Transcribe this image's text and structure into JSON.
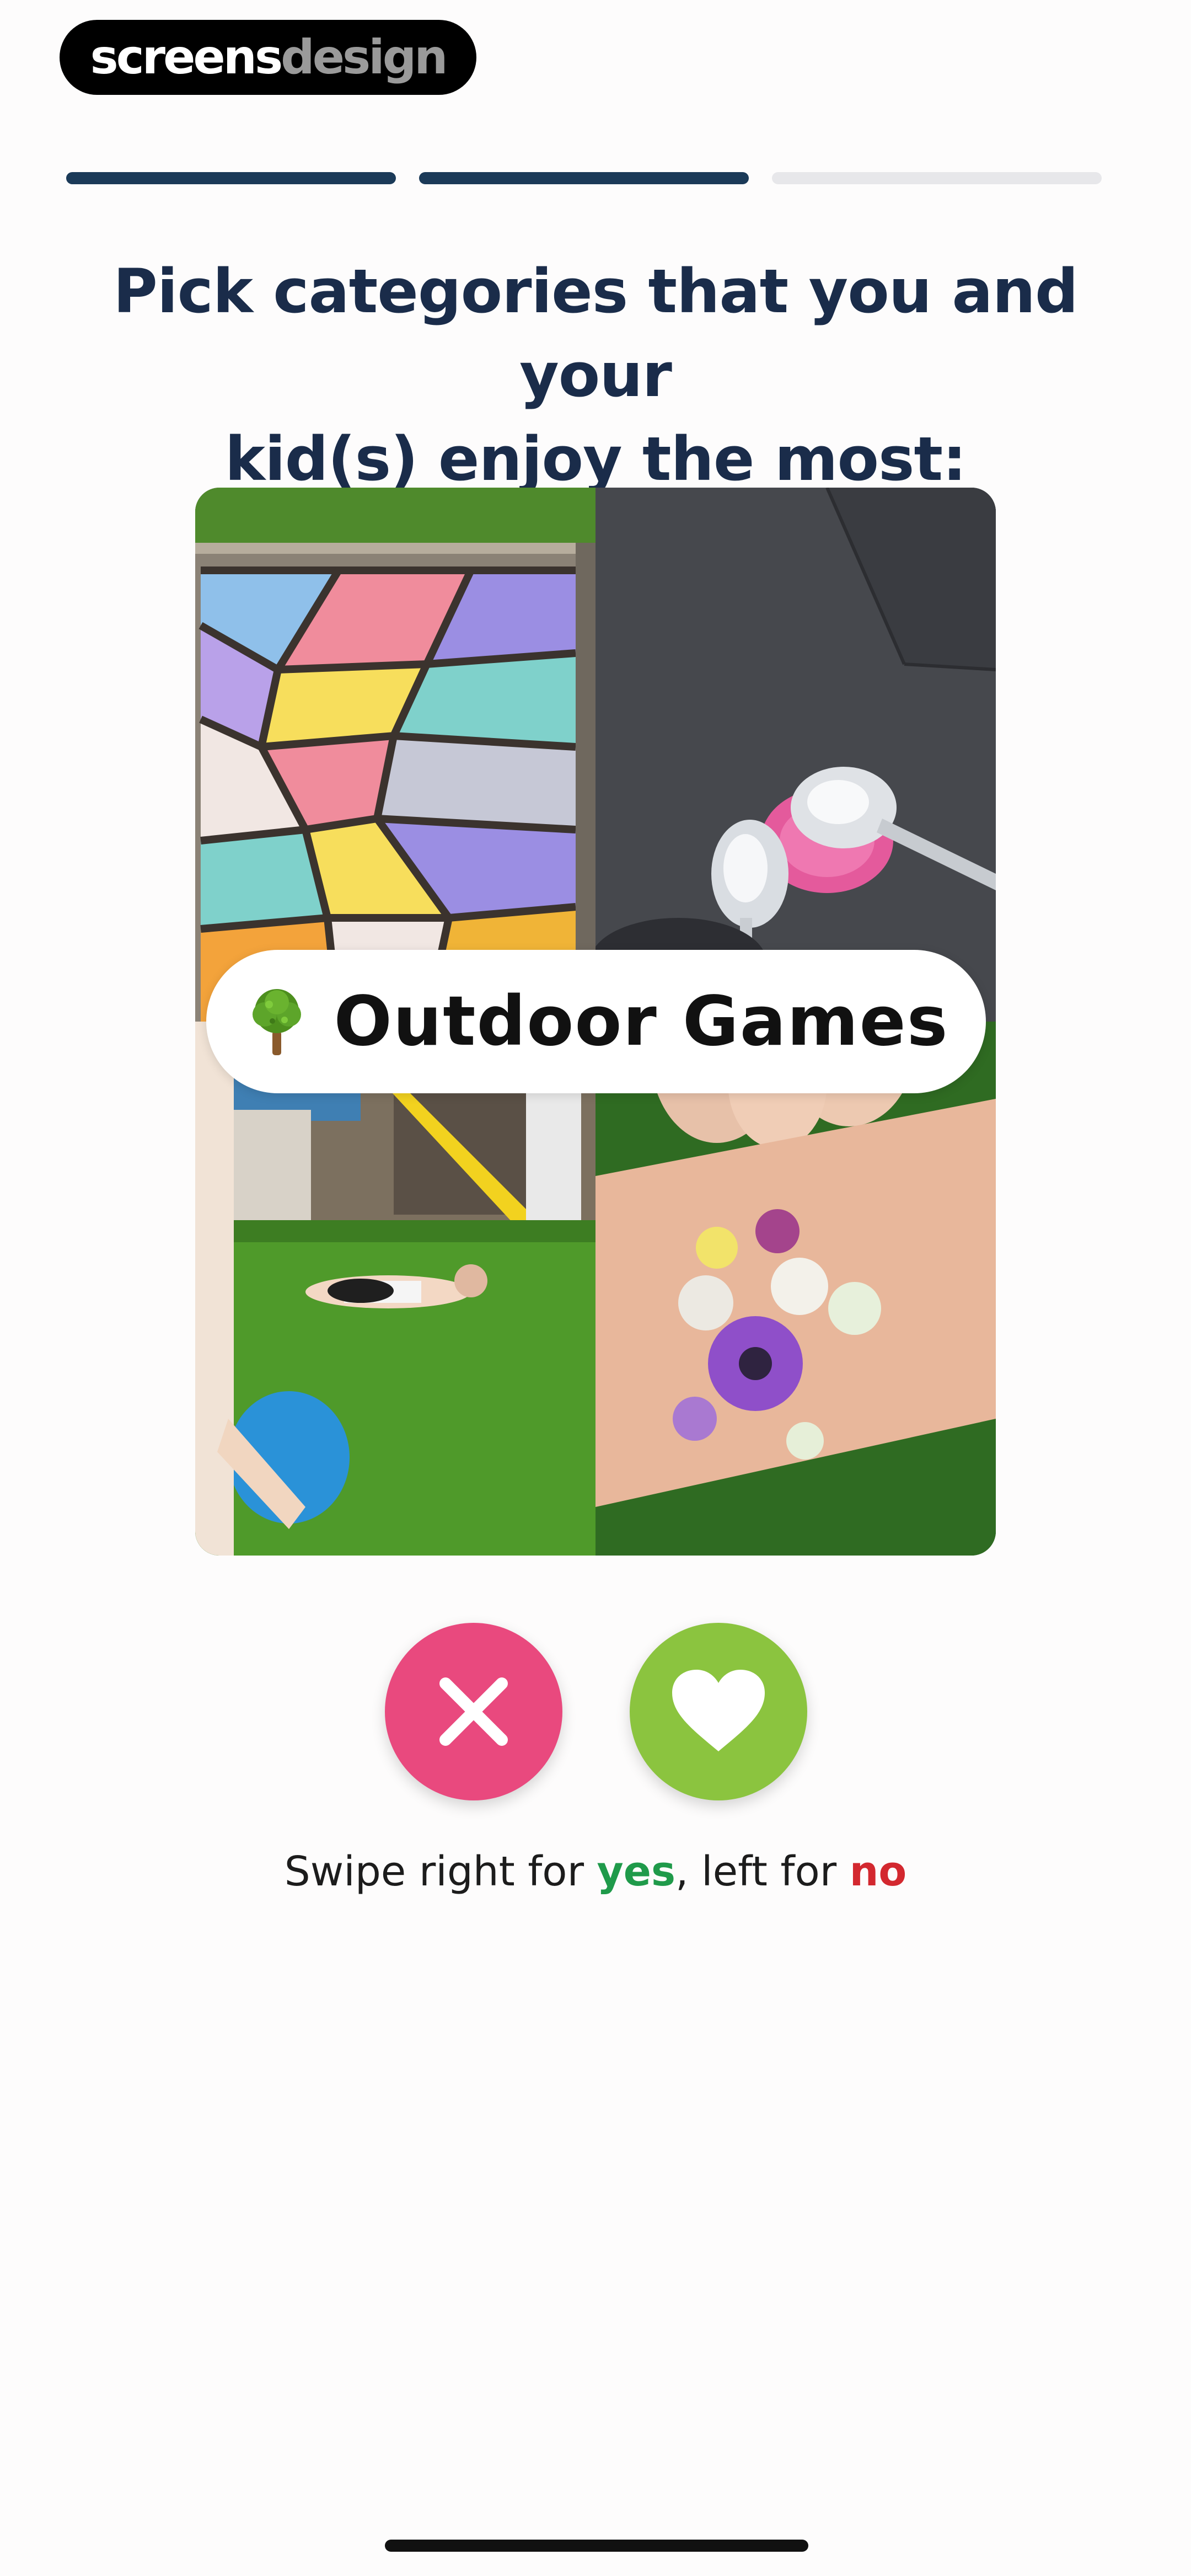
{
  "watermark": {
    "part1": "screens",
    "part2": "design"
  },
  "progress": {
    "total_steps": 3,
    "completed_steps": 2
  },
  "title": {
    "line1": "Pick categories that you and your",
    "line2": "kid(s) enjoy the most:"
  },
  "card": {
    "category_label": "Outdoor Games",
    "category_icon": "deciduous-tree-emoji"
  },
  "actions": {
    "no_icon": "close-x-icon",
    "yes_icon": "heart-icon",
    "no_color": "#e9497e",
    "yes_color": "#8bc43f"
  },
  "hint": {
    "prefix": "Swipe right for ",
    "yes": "yes",
    "middle": ", left for ",
    "no": "no",
    "yes_color": "#1f9a4a",
    "no_color": "#d3282f"
  },
  "colors": {
    "heading": "#1a2c4a",
    "progress_active": "#1b3a58",
    "progress_inactive": "#e7e7ea"
  }
}
